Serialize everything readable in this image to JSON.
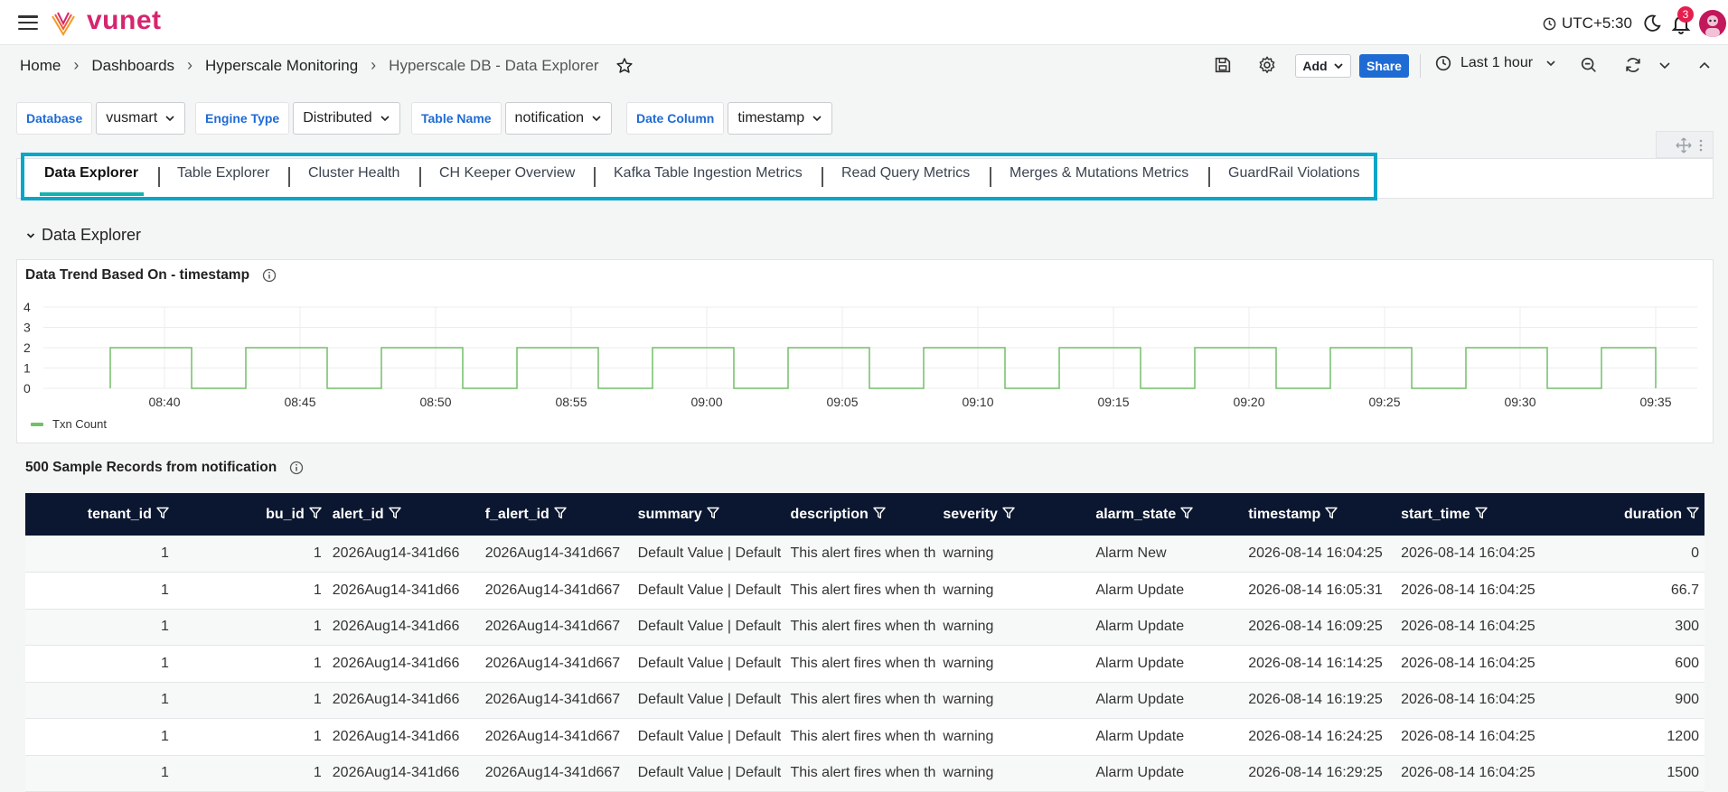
{
  "app": {
    "brand": "vunet",
    "timezone": "UTC+5:30",
    "notification_count": "3"
  },
  "breadcrumb": [
    "Home",
    "Dashboards",
    "Hyperscale Monitoring",
    "Hyperscale DB - Data Explorer"
  ],
  "toolbar": {
    "add_label": "Add",
    "share_label": "Share",
    "time_range": "Last 1 hour"
  },
  "variables": [
    {
      "label": "Database",
      "value": "vusmart"
    },
    {
      "label": "Engine Type",
      "value": "Distributed"
    },
    {
      "label": "Table Name",
      "value": "notification"
    },
    {
      "label": "Date Column",
      "value": "timestamp"
    }
  ],
  "tabs": [
    "Data Explorer",
    "Table Explorer",
    "Cluster Health",
    "CH Keeper Overview",
    "Kafka Table Ingestion Metrics",
    "Read Query Metrics",
    "Merges & Mutations Metrics",
    "GuardRail Violations"
  ],
  "active_tab": "Data Explorer",
  "section_title": "Data Explorer",
  "chart_panel": {
    "title": "Data Trend Based On - timestamp",
    "chart_data": {
      "type": "line",
      "x": [
        "08:40",
        "08:45",
        "08:50",
        "08:55",
        "09:00",
        "09:05",
        "09:10",
        "09:15",
        "09:20",
        "09:25",
        "09:30",
        "09:35"
      ],
      "y_ticks": [
        0,
        1,
        2,
        3,
        4
      ],
      "ylim": [
        0,
        4
      ],
      "series": [
        {
          "name": "Txn Count",
          "color": "#73bf69",
          "pulse_value": 2,
          "pulses": [
            [
              "08:38",
              "08:41"
            ],
            [
              "08:43",
              "08:46"
            ],
            [
              "08:48",
              "08:51"
            ],
            [
              "08:53",
              "08:56"
            ],
            [
              "08:58",
              "09:01"
            ],
            [
              "09:03",
              "09:06"
            ],
            [
              "09:08",
              "09:11"
            ],
            [
              "09:13",
              "09:16"
            ],
            [
              "09:18",
              "09:21"
            ],
            [
              "09:23",
              "09:26"
            ],
            [
              "09:28",
              "09:31"
            ],
            [
              "09:33",
              "09:35"
            ]
          ]
        }
      ],
      "legend": "bottom-left",
      "grid": true
    }
  },
  "table_panel": {
    "title": "500 Sample Records from notification",
    "columns": [
      {
        "name": "tenant_id",
        "align": "num"
      },
      {
        "name": "bu_id",
        "align": "num"
      },
      {
        "name": "alert_id",
        "align": "txt"
      },
      {
        "name": "f_alert_id",
        "align": "txt"
      },
      {
        "name": "summary",
        "align": "txt"
      },
      {
        "name": "description",
        "align": "txt"
      },
      {
        "name": "severity",
        "align": "txt"
      },
      {
        "name": "alarm_state",
        "align": "txt"
      },
      {
        "name": "timestamp",
        "align": "txt"
      },
      {
        "name": "start_time",
        "align": "txt"
      },
      {
        "name": "duration",
        "align": "num"
      }
    ],
    "rows": [
      [
        "1",
        "1",
        "2026Aug14-341d66",
        "2026Aug14-341d667",
        "Default Value | Default",
        "This alert fires when th",
        "warning",
        "Alarm New",
        "2026-08-14 16:04:25",
        "2026-08-14 16:04:25",
        "0"
      ],
      [
        "1",
        "1",
        "2026Aug14-341d66",
        "2026Aug14-341d667",
        "Default Value | Default",
        "This alert fires when th",
        "warning",
        "Alarm Update",
        "2026-08-14 16:05:31",
        "2026-08-14 16:04:25",
        "66.7"
      ],
      [
        "1",
        "1",
        "2026Aug14-341d66",
        "2026Aug14-341d667",
        "Default Value | Default",
        "This alert fires when th",
        "warning",
        "Alarm Update",
        "2026-08-14 16:09:25",
        "2026-08-14 16:04:25",
        "300"
      ],
      [
        "1",
        "1",
        "2026Aug14-341d66",
        "2026Aug14-341d667",
        "Default Value | Default",
        "This alert fires when th",
        "warning",
        "Alarm Update",
        "2026-08-14 16:14:25",
        "2026-08-14 16:04:25",
        "600"
      ],
      [
        "1",
        "1",
        "2026Aug14-341d66",
        "2026Aug14-341d667",
        "Default Value | Default",
        "This alert fires when th",
        "warning",
        "Alarm Update",
        "2026-08-14 16:19:25",
        "2026-08-14 16:04:25",
        "900"
      ],
      [
        "1",
        "1",
        "2026Aug14-341d66",
        "2026Aug14-341d667",
        "Default Value | Default",
        "This alert fires when th",
        "warning",
        "Alarm Update",
        "2026-08-14 16:24:25",
        "2026-08-14 16:04:25",
        "1200"
      ],
      [
        "1",
        "1",
        "2026Aug14-341d66",
        "2026Aug14-341d667",
        "Default Value | Default",
        "This alert fires when th",
        "warning",
        "Alarm Update",
        "2026-08-14 16:29:25",
        "2026-08-14 16:04:25",
        "1500"
      ]
    ]
  },
  "colors": {
    "brand": "#d6256f",
    "accent": "#1f6bd4",
    "tab_highlight": "#0aa6c8",
    "table_header": "#0b1730",
    "series": "#73bf69"
  },
  "icons": {
    "menu": "hamburger-icon",
    "clock": "clock-icon",
    "theme": "moon-icon",
    "notifications": "bell-icon",
    "save": "save-icon",
    "settings": "gear-icon",
    "favorite": "star-icon",
    "zoom_out": "zoom-out-icon",
    "refresh": "refresh-icon",
    "collapse": "chevron-up-icon",
    "info": "info-icon",
    "filter": "filter-icon"
  }
}
